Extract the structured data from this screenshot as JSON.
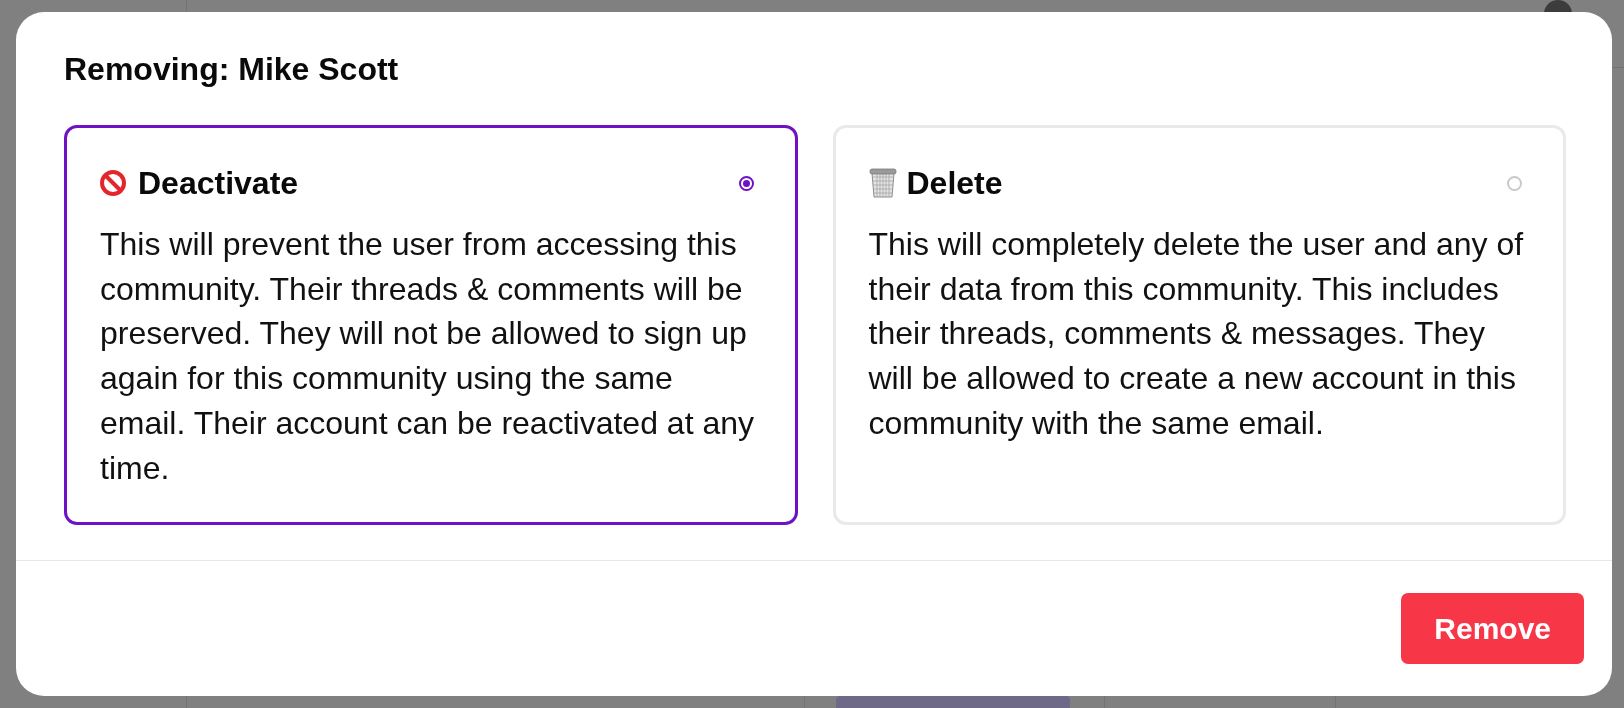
{
  "dialog": {
    "title": "Removing: Mike Scott",
    "options": [
      {
        "kind": "deactivate",
        "label": "Deactivate",
        "description": "This will prevent the user from accessing this community. Their threads & comments will be preserved. They will not be allowed to sign up again for this community using the same email. Their account can be reactivated at any time.",
        "selected": true
      },
      {
        "kind": "delete",
        "label": "Delete",
        "description": "This will completely delete the user and any of their data from this community. This includes their threads, comments & messages. They will be allowed to create a new account in this community with the same email.",
        "selected": false
      }
    ],
    "confirm_button": {
      "label": "Remove"
    }
  }
}
